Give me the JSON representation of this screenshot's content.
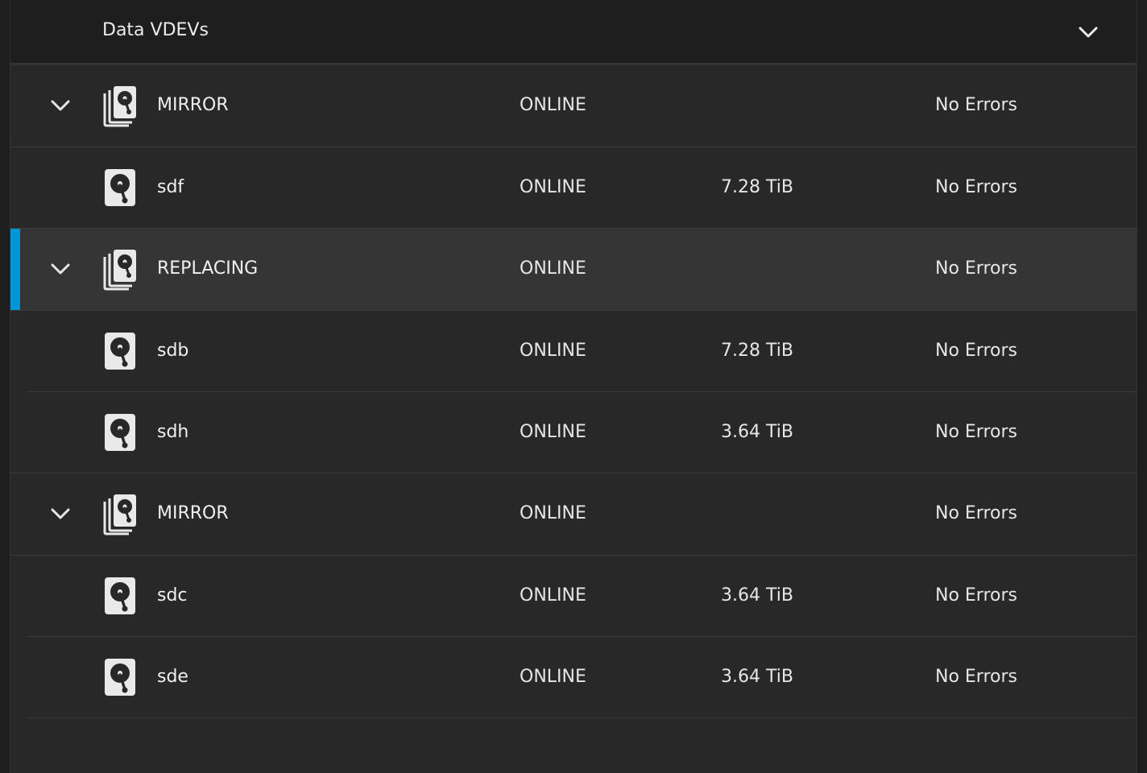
{
  "header": {
    "title": "Data VDEVs"
  },
  "rows": [
    {
      "type": "vdev",
      "name": "MIRROR",
      "status": "ONLINE",
      "size": "",
      "errors": "No Errors"
    },
    {
      "type": "disk",
      "name": "sdf",
      "status": "ONLINE",
      "size": "7.28 TiB",
      "errors": "No Errors"
    },
    {
      "type": "vdev",
      "name": "REPLACING",
      "status": "ONLINE",
      "size": "",
      "errors": "No Errors",
      "selected": true
    },
    {
      "type": "disk",
      "name": "sdb",
      "status": "ONLINE",
      "size": "7.28 TiB",
      "errors": "No Errors"
    },
    {
      "type": "disk",
      "name": "sdh",
      "status": "ONLINE",
      "size": "3.64 TiB",
      "errors": "No Errors"
    },
    {
      "type": "vdev",
      "name": "MIRROR",
      "status": "ONLINE",
      "size": "",
      "errors": "No Errors"
    },
    {
      "type": "disk",
      "name": "sdc",
      "status": "ONLINE",
      "size": "3.64 TiB",
      "errors": "No Errors"
    },
    {
      "type": "disk",
      "name": "sde",
      "status": "ONLINE",
      "size": "3.64 TiB",
      "errors": "No Errors"
    }
  ],
  "icons": {
    "vdev": "disk-stack-icon",
    "disk": "hard-disk-icon",
    "expand": "chevron-down-icon"
  },
  "colors": {
    "accent": "#0095d5",
    "background": "#282828",
    "header_background": "#1e1e1e",
    "selected_row": "#353535",
    "text": "#e6e6e6"
  }
}
